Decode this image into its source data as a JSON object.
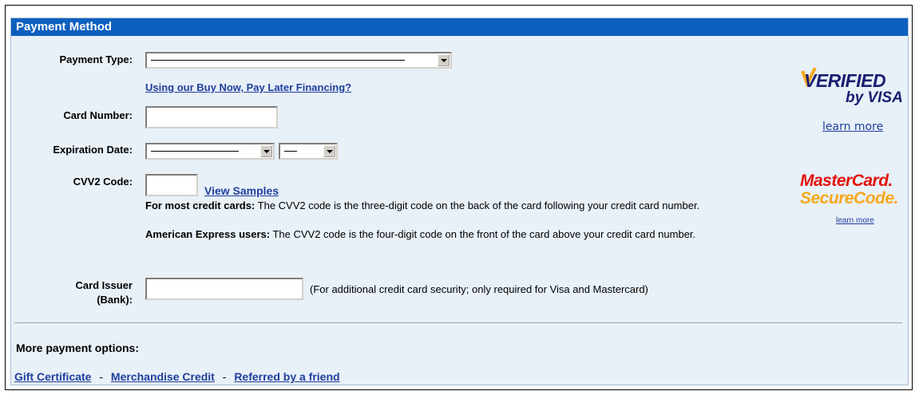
{
  "section": {
    "title": "Payment Method"
  },
  "payment_type": {
    "label": "Payment Type:",
    "financing_link": "Using our Buy Now, Pay Later Financing?"
  },
  "card_number": {
    "label": "Card Number:",
    "value": ""
  },
  "expiration": {
    "label": "Expiration Date:"
  },
  "cvv2": {
    "label": "CVV2 Code:",
    "value": "",
    "samples_link": "View Samples",
    "most_cards_bold": "For most credit cards:",
    "most_cards_text": " The CVV2 code is the three-digit code on the back of the card following your credit card number.",
    "amex_bold": "American Express users:",
    "amex_text": " The CVV2 code is the four-digit code on the front of the card above your credit card number."
  },
  "card_issuer": {
    "label_line1": "Card Issuer",
    "label_line2": "(Bank):",
    "value": "",
    "note": "(For additional credit card security; only required for Visa and Mastercard)"
  },
  "verified_visa": {
    "line1": "VERIFIED",
    "line2": "by VISA",
    "learn_more": "learn more"
  },
  "mastercard": {
    "line1": "MasterCard.",
    "line2": "SecureCode.",
    "learn_more": "learn more"
  },
  "more_options": {
    "heading": "More payment options:",
    "links": [
      "Gift Certificate",
      "Merchandise Credit",
      "Referred by a friend"
    ],
    "separator": "-"
  },
  "colors": {
    "header_bg": "#0d5fbf",
    "panel_bg": "#e8f0f8",
    "link": "#1f3f9c",
    "mastercard_red": "#e3120b",
    "mastercard_yellow": "#f6a81c",
    "visa_blue": "#1a1f71"
  }
}
